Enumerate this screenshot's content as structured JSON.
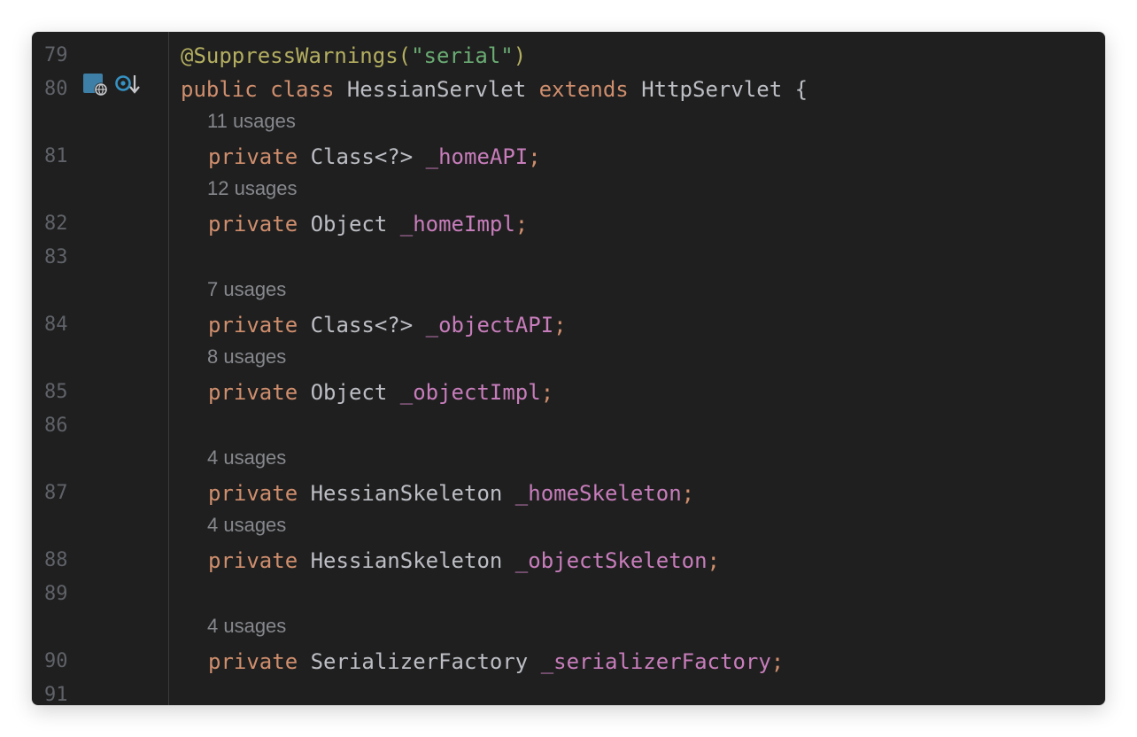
{
  "lines": [
    {
      "num": "79",
      "parts": [
        "@SuppressWarnings(",
        "\"serial\"",
        ")"
      ]
    },
    {
      "num": "80",
      "parts": [
        "public",
        " ",
        "class",
        " HessianServlet ",
        "extends",
        " HttpServlet {"
      ]
    },
    {
      "num": "81",
      "hint": "11 usages",
      "parts": [
        "private",
        " Class<?> ",
        "_homeAPI",
        ";"
      ]
    },
    {
      "num": "82",
      "hint": "12 usages",
      "parts": [
        "private",
        " Object ",
        "_homeImpl",
        ";"
      ]
    },
    {
      "num": "83"
    },
    {
      "num": "84",
      "hint": "7 usages",
      "parts": [
        "private",
        " Class<?> ",
        "_objectAPI",
        ";"
      ]
    },
    {
      "num": "85",
      "hint": "8 usages",
      "parts": [
        "private",
        " Object ",
        "_objectImpl",
        ";"
      ]
    },
    {
      "num": "86"
    },
    {
      "num": "87",
      "hint": "4 usages",
      "parts": [
        "private",
        " HessianSkeleton ",
        "_homeSkeleton",
        ";"
      ]
    },
    {
      "num": "88",
      "hint": "4 usages",
      "parts": [
        "private",
        " HessianSkeleton ",
        "_objectSkeleton",
        ";"
      ]
    },
    {
      "num": "89"
    },
    {
      "num": "90",
      "hint": "4 usages",
      "parts": [
        "private",
        " SerializerFactory ",
        "_serializerFactory",
        ";"
      ]
    },
    {
      "num": "91"
    }
  ],
  "gutter_icons": [
    "servlet-web-icon",
    "override-down-icon"
  ],
  "colors": {
    "background": "#1f1f1f",
    "keyword": "#cf8e6d",
    "annotation": "#b3ae60",
    "string": "#6aab73",
    "field": "#c77dbb",
    "text": "#bcbec4",
    "line_number": "#5f6268",
    "inlay_hint": "#86888d"
  }
}
